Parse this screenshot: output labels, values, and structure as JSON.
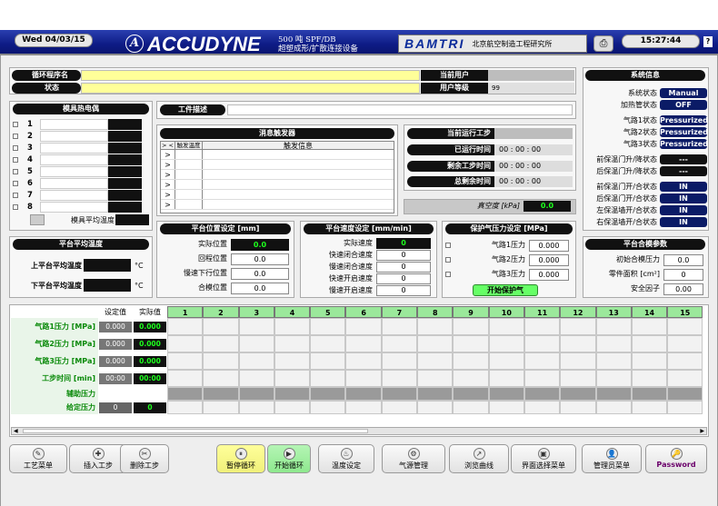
{
  "header": {
    "date": "Wed  04/03/15",
    "brand": "ACCUDYNE",
    "logo_letter": "A",
    "sub1": "500 吨 SPF/DB",
    "sub2": "超塑成形/扩散连接设备",
    "bamtri": "BAMTRI",
    "institute": "北京航空制造工程研究所",
    "time": "15:27:44",
    "help": "?",
    "icons": {
      "print": "printer-icon"
    }
  },
  "cycle": {
    "program_label": "循环程序名",
    "state_label": "状态",
    "user_label": "当前用户",
    "level_label": "用户等级",
    "level_value": "99"
  },
  "thermo": {
    "title": "模具热电偶",
    "rows": [
      "1",
      "2",
      "3",
      "4",
      "5",
      "6",
      "7",
      "8"
    ],
    "avg_label": "模具平均温度"
  },
  "work": {
    "label": "工件描述"
  },
  "system": {
    "title": "系统信息",
    "items": [
      {
        "label": "系统状态",
        "value": "Manual"
      },
      {
        "label": "加热管状态",
        "value": "OFF"
      },
      {
        "label": "气路1状态",
        "value": "Pressurized"
      },
      {
        "label": "气路2状态",
        "value": "Pressurized"
      },
      {
        "label": "气路3状态",
        "value": "Pressurized"
      },
      {
        "label": "前保温门升/降状态",
        "value": "---"
      },
      {
        "label": "后保温门升/降状态",
        "value": "---"
      },
      {
        "label": "前保温门开/合状态",
        "value": "IN"
      },
      {
        "label": "后保温门开/合状态",
        "value": "IN"
      },
      {
        "label": "左保温墙开/合状态",
        "value": "IN"
      },
      {
        "label": "右保温墙开/合状态",
        "value": "IN"
      }
    ]
  },
  "messages": {
    "title": "消息触发器",
    "col1": "> <",
    "col2": "触发温度",
    "col3": "触发信息",
    "rows": [
      ">",
      ">",
      ">",
      ">",
      ">",
      ">"
    ]
  },
  "steps": {
    "current": "当前运行工步",
    "elapsed": "已运行时间",
    "elapsed_v": "00 : 00 : 00",
    "remain_step": "剩余工步时间",
    "remain_step_v": "00 : 00 : 00",
    "remain_total": "总剩余时间",
    "remain_total_v": "00 : 00 : 00"
  },
  "vacuum": {
    "label": "真空度 [kPa]",
    "value": "0.0"
  },
  "platen_temp": {
    "title": "平台平均温度",
    "upper": "上平台平均温度",
    "lower": "下平台平均温度",
    "unit": "°C"
  },
  "position": {
    "title": "平台位置设定   [mm]",
    "items": [
      {
        "label": "实际位置",
        "value": "0.0"
      },
      {
        "label": "回程位置",
        "value": "0.0"
      },
      {
        "label": "慢速下行位置",
        "value": "0.0"
      },
      {
        "label": "合模位置",
        "value": "0.0"
      }
    ]
  },
  "speed": {
    "title": "平台速度设定   [mm/min]",
    "items": [
      {
        "label": "实际速度",
        "value": "0"
      },
      {
        "label": "快速闭合速度",
        "value": "0"
      },
      {
        "label": "慢速闭合速度",
        "value": "0"
      },
      {
        "label": "快速开启速度",
        "value": "0"
      },
      {
        "label": "慢速开启速度",
        "value": "0"
      }
    ]
  },
  "protect": {
    "title": "保护气压力设定 [MPa]",
    "items": [
      {
        "label": "气路1压力",
        "value": "0.000"
      },
      {
        "label": "气路2压力",
        "value": "0.000"
      },
      {
        "label": "气路3压力",
        "value": "0.000"
      }
    ],
    "start": "开始保护气"
  },
  "clamp": {
    "title": "平台合模参数",
    "items": [
      {
        "label": "初始合模压力",
        "value": "0.0"
      },
      {
        "label": "零件面积 [cm²]",
        "value": "0"
      },
      {
        "label": "安全因子",
        "value": "0.00"
      }
    ]
  },
  "grid": {
    "set_label": "设定值",
    "actual_label": "实际值",
    "cols": [
      "1",
      "2",
      "3",
      "4",
      "5",
      "6",
      "7",
      "8",
      "9",
      "10",
      "11",
      "12",
      "13",
      "14",
      "15"
    ],
    "rows": [
      {
        "label": "气路1压力 [MPa]",
        "set": "0.000",
        "actual": "0.000"
      },
      {
        "label": "气路2压力 [MPa]",
        "set": "0.000",
        "actual": "0.000"
      },
      {
        "label": "气路3压力 [MPa]",
        "set": "0.000",
        "actual": "0.000"
      },
      {
        "label": "工步时间 [min]",
        "set": "00:00",
        "actual": "00:00"
      },
      {
        "label": "辅助压力",
        "set": "",
        "actual": ""
      },
      {
        "label": "给定压力",
        "set": "0",
        "actual": "0"
      }
    ]
  },
  "buttons": [
    "工艺菜单",
    "插入工步",
    "删除工步",
    "暂停循环",
    "开始循环",
    "温度设定",
    "气源管理",
    "浏览曲线",
    "界面选择菜单",
    "管理员菜单",
    "Password"
  ],
  "colors": {
    "accent": "#0e1c86",
    "green": "#1dff1d",
    "yellow": "#ffff99"
  }
}
